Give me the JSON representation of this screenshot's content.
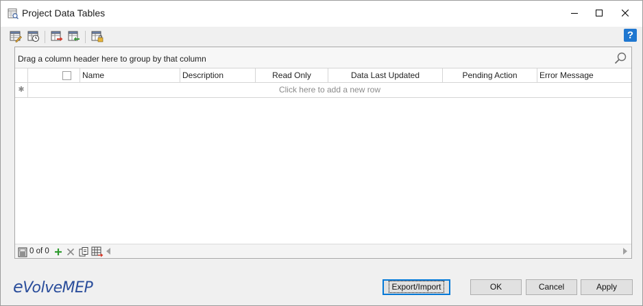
{
  "window": {
    "title": "Project Data Tables"
  },
  "toolbar": {
    "buttons": [
      "edit-table-icon",
      "table-history-icon",
      "export-table-icon",
      "import-table-icon",
      "table-lock-icon"
    ],
    "help_label": "?"
  },
  "grid": {
    "group_panel_text": "Drag a column header here to group by that column",
    "columns": [
      {
        "label": ""
      },
      {
        "label": "Name"
      },
      {
        "label": "Description"
      },
      {
        "label": "Read Only"
      },
      {
        "label": "Data Last Updated"
      },
      {
        "label": "Pending Action"
      },
      {
        "label": "Error Message"
      }
    ],
    "new_row_indicator": "✱",
    "new_row_text": "Click here to add a new row",
    "navigator": {
      "record_count": "0 of 0"
    }
  },
  "footer": {
    "logo_text_e": "e",
    "logo_text_rest": "VolveMEP",
    "export_import_label": "Export/Import",
    "ok_label": "OK",
    "cancel_label": "Cancel",
    "apply_label": "Apply"
  },
  "colors": {
    "accent": "#0078d7",
    "logo": "#2a4d9b",
    "help": "#1f77d0"
  }
}
